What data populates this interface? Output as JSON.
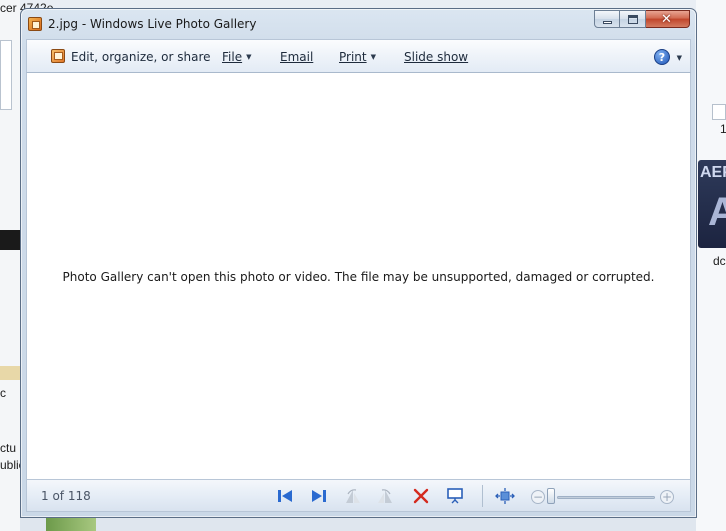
{
  "background": {
    "left_text_top": "cer 4742e",
    "left_text_c": "c",
    "left_text_ctu": "ctu",
    "left_text_ublic": "ublic",
    "right_text_1": "1",
    "right_aep": "AEP",
    "right_a": "A",
    "right_dc": "dc"
  },
  "window": {
    "title": "2.jpg - Windows Live Photo Gallery",
    "close_glyph": "✕"
  },
  "menu": {
    "edit_label": "Edit, organize, or share",
    "file_label": "File",
    "email_label": "Email",
    "print_label": "Print",
    "slideshow_label": "Slide show",
    "help_glyph": "?"
  },
  "content": {
    "message": "Photo Gallery can't open this photo or video. The file may be unsupported, damaged or corrupted."
  },
  "bottom": {
    "counter": "1 of 118",
    "zoom_minus": "−",
    "zoom_plus": "+"
  },
  "colors": {
    "accent": "#1f56b8",
    "close": "#c1452b",
    "nav_blue": "#2a6ad0",
    "delete_red": "#d42a1e"
  }
}
